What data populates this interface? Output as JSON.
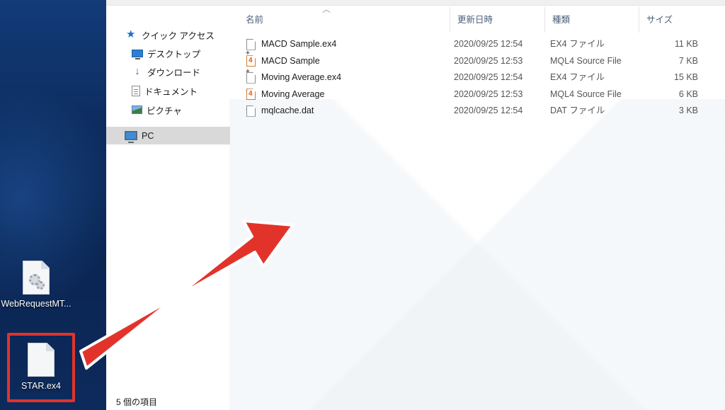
{
  "desktop": {
    "icons": [
      {
        "label": "WebRequestMT..."
      },
      {
        "label": "STAR.ex4"
      }
    ]
  },
  "nav": {
    "quick_access": "クイック アクセス",
    "desktop": "デスクトップ",
    "downloads": "ダウンロード",
    "documents": "ドキュメント",
    "pictures": "ピクチャ",
    "pc": "PC"
  },
  "file_list": {
    "columns": {
      "name": "名前",
      "date_modified": "更新日時",
      "type": "種類",
      "size": "サイズ"
    },
    "rows": [
      {
        "name": "MACD Sample.ex4",
        "date": "2020/09/25 12:54",
        "type": "EX4 ファイル",
        "size": "11 KB",
        "icon": "generic-file-icon"
      },
      {
        "name": "MACD Sample",
        "date": "2020/09/25 12:53",
        "type": "MQL4 Source File",
        "size": "7 KB",
        "icon": "mql4-file-icon"
      },
      {
        "name": "Moving Average.ex4",
        "date": "2020/09/25 12:54",
        "type": "EX4 ファイル",
        "size": "15 KB",
        "icon": "generic-file-icon"
      },
      {
        "name": "Moving Average",
        "date": "2020/09/25 12:53",
        "type": "MQL4 Source File",
        "size": "6 KB",
        "icon": "mql4-file-icon"
      },
      {
        "name": "mqlcache.dat",
        "date": "2020/09/25 12:54",
        "type": "DAT ファイル",
        "size": "3 KB",
        "icon": "generic-file-icon"
      }
    ]
  },
  "status": {
    "item_count": "5 個の項目"
  },
  "colors": {
    "annotation": "#e2332b",
    "selection": "#d9d9d9",
    "accent": "#1f6fc6"
  }
}
